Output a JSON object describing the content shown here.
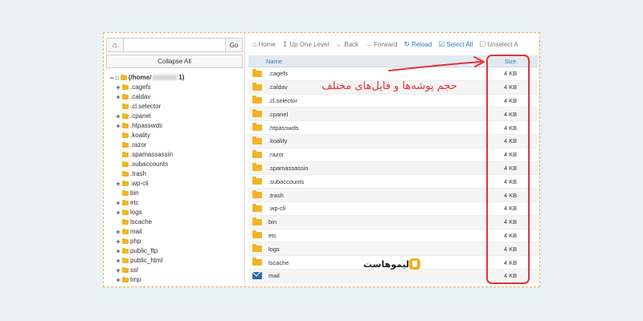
{
  "left": {
    "go_label": "Go",
    "path_value": "",
    "collapse_label": "Collapse All",
    "root_prefix": "(/home/",
    "root_suffix": "1)",
    "tree": [
      {
        "label": ".cagefs",
        "expand": "+"
      },
      {
        "label": ".caldav",
        "expand": "+"
      },
      {
        "label": ".cl.selector",
        "expand": ""
      },
      {
        "label": ".cpanel",
        "expand": "+"
      },
      {
        "label": ".htpasswds",
        "expand": "+"
      },
      {
        "label": ".koality",
        "expand": ""
      },
      {
        "label": ".razor",
        "expand": ""
      },
      {
        "label": ".spamassassin",
        "expand": ""
      },
      {
        "label": ".subaccounts",
        "expand": ""
      },
      {
        "label": ".trash",
        "expand": ""
      },
      {
        "label": ".wp-cli",
        "expand": "+"
      },
      {
        "label": "bin",
        "expand": ""
      },
      {
        "label": "etc",
        "expand": "+"
      },
      {
        "label": "logs",
        "expand": "+"
      },
      {
        "label": "lscache",
        "expand": ""
      },
      {
        "label": "mail",
        "expand": "+"
      },
      {
        "label": "php",
        "expand": "+"
      },
      {
        "label": "public_ftp",
        "expand": "+"
      },
      {
        "label": "public_html",
        "expand": "+"
      },
      {
        "label": "ssl",
        "expand": "+"
      },
      {
        "label": "tmp",
        "expand": "+"
      }
    ]
  },
  "toolbar": {
    "home": "Home",
    "up_one_level": "Up One Level",
    "back": "Back",
    "forward": "Forward",
    "reload": "Reload",
    "select_all": "Select All",
    "unselect_all": "Unselect A"
  },
  "table": {
    "col_name": "Name",
    "col_size": "Size",
    "rows": [
      {
        "name": ".cagefs",
        "size": "4 KB",
        "icon": "folder-icon"
      },
      {
        "name": ".caldav",
        "size": "4 KB",
        "icon": "folder-icon"
      },
      {
        "name": ".cl.selector",
        "size": "4 KB",
        "icon": "folder-icon"
      },
      {
        "name": ".cpanel",
        "size": "4 KB",
        "icon": "folder-icon"
      },
      {
        "name": ".htpasswds",
        "size": "4 KB",
        "icon": "folder-icon"
      },
      {
        "name": ".koality",
        "size": "4 KB",
        "icon": "folder-icon"
      },
      {
        "name": ".razor",
        "size": "4 KB",
        "icon": "folder-icon"
      },
      {
        "name": ".spamassassin",
        "size": "4 KB",
        "icon": "folder-icon"
      },
      {
        "name": ".subaccounts",
        "size": "4 KB",
        "icon": "folder-icon"
      },
      {
        "name": ".trash",
        "size": "4 KB",
        "icon": "folder-icon"
      },
      {
        "name": ".wp-cli",
        "size": "4 KB",
        "icon": "folder-icon"
      },
      {
        "name": "bin",
        "size": "4 KB",
        "icon": "folder-icon"
      },
      {
        "name": "etc",
        "size": "4 KB",
        "icon": "folder-icon"
      },
      {
        "name": "logs",
        "size": "4 KB",
        "icon": "folder-icon"
      },
      {
        "name": "lscache",
        "size": "4 KB",
        "icon": "folder-icon"
      },
      {
        "name": "mail",
        "size": "4 KB",
        "icon": "mail-folder-icon"
      }
    ]
  },
  "annotation": {
    "text": "حجم پوشه‌ها و فایل‌های مختلف",
    "color": "#e0333b"
  },
  "brand": {
    "name": "لیموهاست"
  },
  "colors": {
    "folder": "#f0b429",
    "link": "#2f7ab8",
    "frame_border": "#f0a860",
    "background": "#e9f1f2"
  }
}
